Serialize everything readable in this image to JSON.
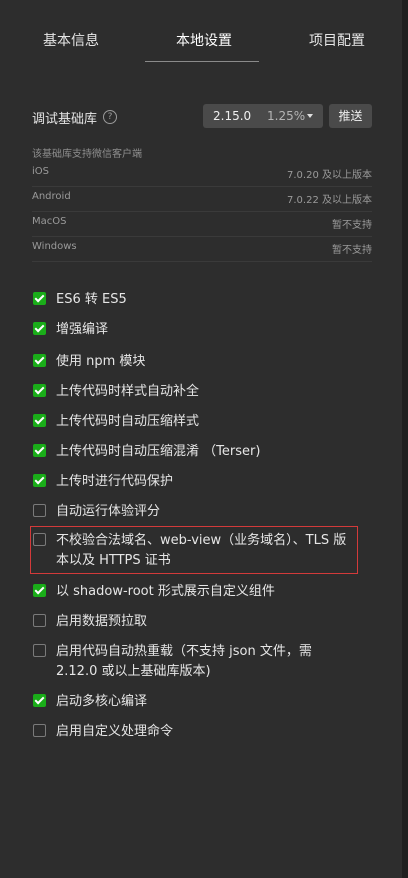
{
  "tabs": [
    {
      "label": "基本信息"
    },
    {
      "label": "本地设置"
    },
    {
      "label": "项目配置"
    }
  ],
  "sdk": {
    "label": "调试基础库",
    "help_icon": "question-circle-icon",
    "version": "2.15.0",
    "usage": "1.25%",
    "push_label": "推送"
  },
  "clients": {
    "title": "该基础库支持微信客户端",
    "rows": [
      {
        "name": "iOS",
        "value": "7.0.20 及以上版本"
      },
      {
        "name": "Android",
        "value": "7.0.22 及以上版本"
      },
      {
        "name": "MacOS",
        "value": "暂不支持"
      },
      {
        "name": "Windows",
        "value": "暂不支持"
      }
    ]
  },
  "options": [
    {
      "label": "ES6 转 ES5",
      "checked": true
    },
    {
      "label": "增强编译",
      "checked": true
    },
    {
      "label": "使用 npm 模块",
      "checked": true
    },
    {
      "label": "上传代码时样式自动补全",
      "checked": true
    },
    {
      "label": "上传代码时自动压缩样式",
      "checked": true
    },
    {
      "label": "上传代码时自动压缩混淆 （Terser)",
      "checked": true
    },
    {
      "label": "上传时进行代码保护",
      "checked": true
    },
    {
      "label": "自动运行体验评分",
      "checked": false
    },
    {
      "label": "不校验合法域名、web-view（业务域名）、TLS 版本以及 HTTPS 证书",
      "checked": false
    },
    {
      "label": "以 shadow-root 形式展示自定义组件",
      "checked": true
    },
    {
      "label": "启用数据预拉取",
      "checked": false
    },
    {
      "label": "启用代码自动热重载（不支持 json 文件，需 2.12.0 或以上基础库版本)",
      "checked": false
    },
    {
      "label": "启动多核心编译",
      "checked": true
    },
    {
      "label": "启用自定义处理命令",
      "checked": false
    }
  ],
  "colors": {
    "panel_bg": "#2d2d2d",
    "checkbox_on": "#1aad19",
    "highlight_border": "#d33a3a"
  }
}
